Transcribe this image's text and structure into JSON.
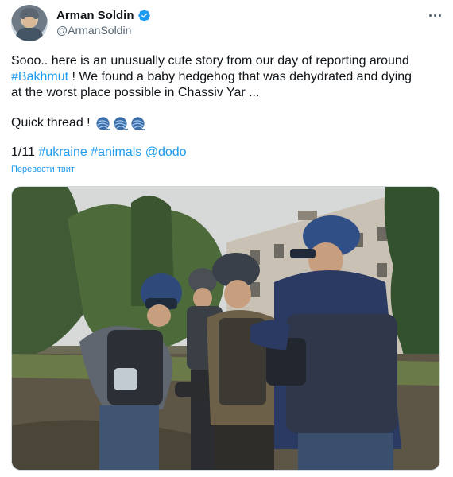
{
  "author": {
    "display_name": "Arman Soldin",
    "handle": "@ArmanSoldin",
    "verified": true,
    "avatar_icon": "avatar-photo"
  },
  "tweet": {
    "line1": "Sooo.. here is an unusually cute story from our day of reporting around",
    "hashtag_bakhmut": "#Bakhmut",
    "line2": " ! We found a baby hedgehog that was dehydrated and dying",
    "line3": "at the worst place possible in Chassiv Yar ...",
    "thread_text": "Quick thread !",
    "emoji_icons": [
      "yarn-icon",
      "yarn-icon",
      "yarn-icon"
    ],
    "counter": "1/11",
    "hashtag_ukraine": "#ukraine",
    "hashtag_animals": "#animals",
    "mention_dodo": "@dodo",
    "translate_label": "Перевести твит"
  },
  "media": {
    "type": "photo",
    "description_icon": "photo-journalists-hedgehog"
  },
  "colors": {
    "link": "#1d9bf0",
    "text": "#0f1419",
    "secondary": "#536471",
    "verified": "#1d9bf0"
  }
}
